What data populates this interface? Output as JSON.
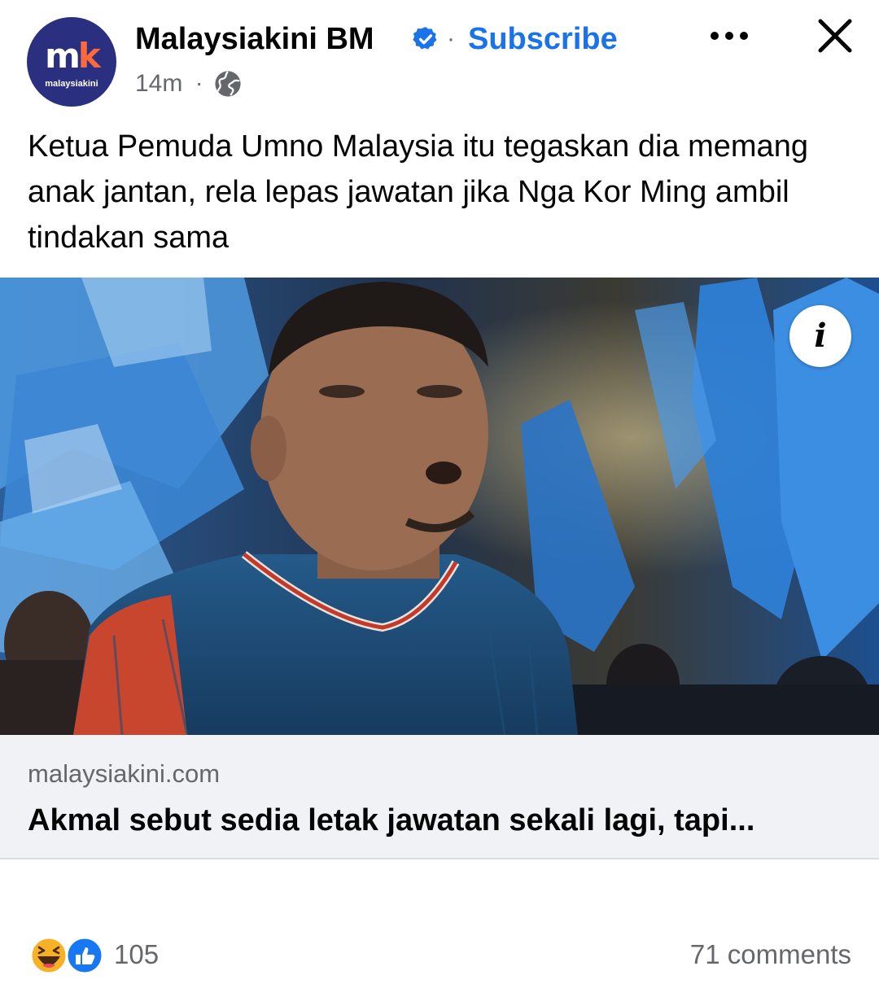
{
  "post": {
    "page_name": "Malaysiakini BM",
    "separator": "·",
    "subscribe_label": "Subscribe",
    "timestamp": "14m",
    "meta_separator": "·",
    "audience_icon": "globe-icon",
    "body_text": "Ketua Pemuda Umno Malaysia itu tegaskan dia memang anak jantan, rela lepas jawatan jika Nga Kor Ming ambil tindakan sama"
  },
  "avatar": {
    "mark_m": "m",
    "mark_k": "k",
    "brand_text": "malaysiakini"
  },
  "link_preview": {
    "info_label": "i",
    "domain": "malaysiakini.com",
    "title": "Akmal sebut sedia letak jawatan sekali lagi, tapi..."
  },
  "footer": {
    "reaction_icons": [
      "haha-icon",
      "like-icon"
    ],
    "reaction_count": "105",
    "comments": "71 comments"
  },
  "colors": {
    "brand_navy": "#2a2f7f",
    "brand_orange": "#ff6a3d",
    "link_blue": "#1a73e8",
    "secondary_text": "#65676b",
    "preview_bg": "#f0f2f5",
    "flag_blue": "#2e7fd6"
  }
}
